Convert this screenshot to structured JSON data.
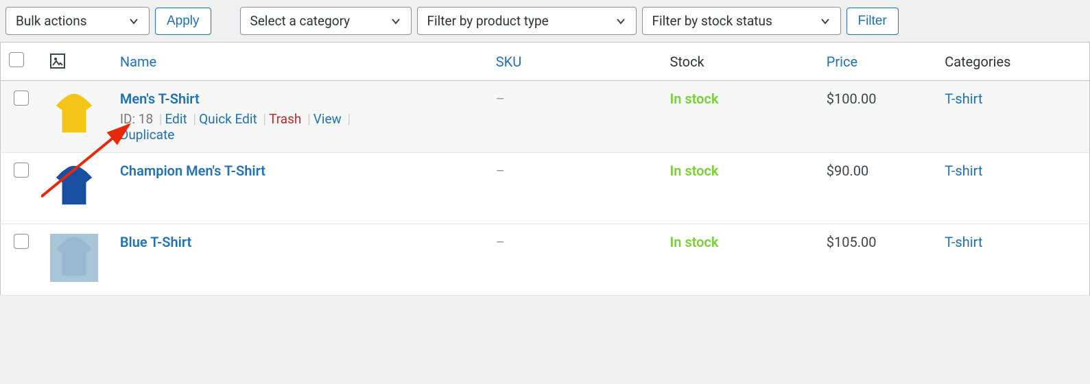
{
  "toolbar": {
    "bulk_actions": "Bulk actions",
    "apply": "Apply",
    "select_category": "Select a category",
    "filter_product_type": "Filter by product type",
    "filter_stock_status": "Filter by stock status",
    "filter": "Filter"
  },
  "columns": {
    "name": "Name",
    "sku": "SKU",
    "stock": "Stock",
    "price": "Price",
    "categories": "Categories"
  },
  "row_actions": {
    "id_prefix": "ID: ",
    "edit": "Edit",
    "quick_edit": "Quick Edit",
    "trash": "Trash",
    "view": "View",
    "duplicate": "Duplicate"
  },
  "products": [
    {
      "name": "Men's T-Shirt",
      "id": "18",
      "sku": "–",
      "stock": "In stock",
      "price": "$100.00",
      "category": "T-shirt",
      "show_actions": true,
      "thumb": "yellow"
    },
    {
      "name": "Champion Men's T-Shirt",
      "id": "",
      "sku": "–",
      "stock": "In stock",
      "price": "$90.00",
      "category": "T-shirt",
      "show_actions": false,
      "thumb": "blue"
    },
    {
      "name": "Blue T-Shirt",
      "id": "",
      "sku": "–",
      "stock": "In stock",
      "price": "$105.00",
      "category": "T-shirt",
      "show_actions": false,
      "thumb": "lightblue"
    }
  ]
}
